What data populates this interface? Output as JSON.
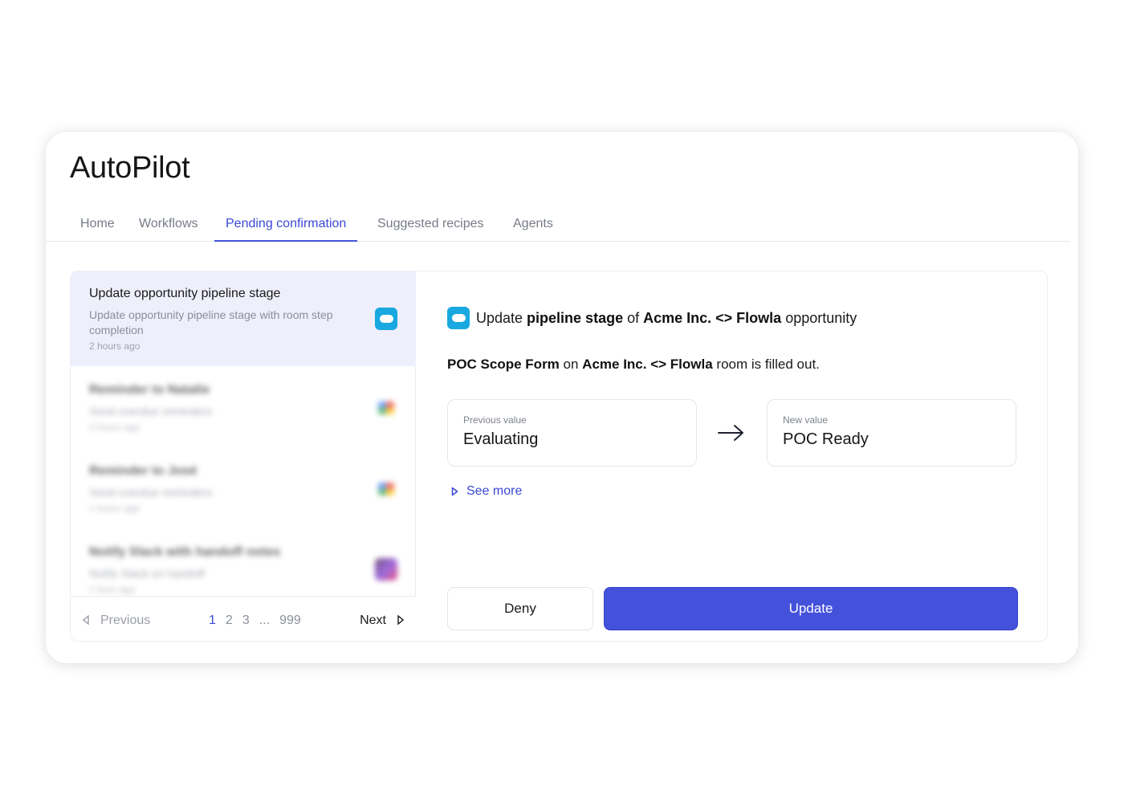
{
  "app": {
    "title": "AutoPilot"
  },
  "tabs": [
    {
      "label": "Home"
    },
    {
      "label": "Workflows"
    },
    {
      "label": "Pending confirmation"
    },
    {
      "label": "Suggested recipes"
    },
    {
      "label": "Agents"
    }
  ],
  "active_tab": "Pending confirmation",
  "list": {
    "items": [
      {
        "title": "Update opportunity pipeline stage",
        "description": "Update opportunity pipeline stage with room step completion",
        "time": "2 hours ago",
        "icon": "salesforce-icon"
      },
      {
        "title": "Reminder to Natalie",
        "description": "Send overdue reminders",
        "time": "2 hours ago",
        "icon": "gmail-icon"
      },
      {
        "title": "Reminder to José",
        "description": "Send overdue reminders",
        "time": "1 hours ago",
        "icon": "gmail-icon"
      },
      {
        "title": "Notify Slack with handoff notes",
        "description": "Notify Slack on handoff",
        "time": "1 hour ago",
        "icon": "slack-icon"
      }
    ]
  },
  "pagination": {
    "previous": "Previous",
    "next": "Next",
    "pages": [
      "1",
      "2",
      "3",
      "...",
      "999"
    ],
    "current": "1"
  },
  "detail": {
    "headline": {
      "t1": "Update ",
      "b1": "pipeline stage",
      "t2": " of ",
      "b2": "Acme Inc. <> Flowla",
      "t3": " opportunity"
    },
    "trigger": {
      "b1": "POC Scope Form",
      "t1": " on ",
      "b2": "Acme Inc. <> Flowla",
      "t2": " room is filled out."
    },
    "previous": {
      "label": "Previous value",
      "value": "Evaluating"
    },
    "new": {
      "label": "New value",
      "value": "POC Ready"
    },
    "see_more": "See more",
    "deny": "Deny",
    "update": "Update"
  },
  "colors": {
    "accent": "#4451db",
    "selected_bg": "#eeeffb",
    "salesforce": "#1aa8e0"
  }
}
